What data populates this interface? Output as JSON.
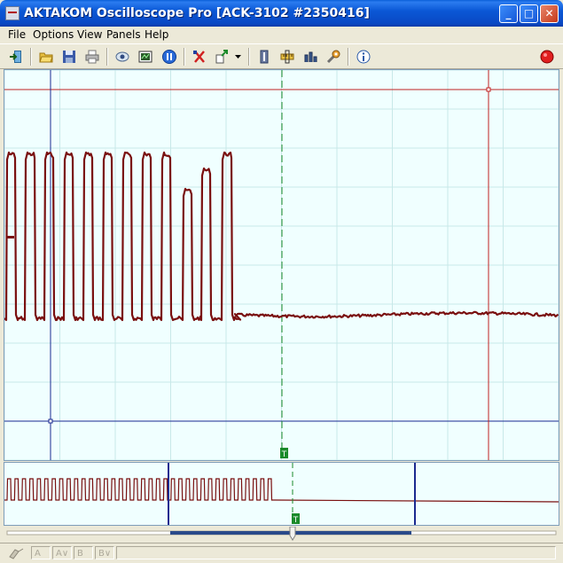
{
  "window": {
    "title": "AKTAKOM Oscilloscope Pro [ACK-3102 #2350416]",
    "minimize_glyph": "_",
    "maximize_glyph": "□",
    "close_glyph": "✕"
  },
  "menu": {
    "file": "File",
    "options": "Options",
    "view": "View",
    "panels": "Panels",
    "help": "Help"
  },
  "toolbar": {
    "icons": [
      "exit-icon",
      "open-folder-icon",
      "save-icon",
      "print-icon",
      "eye-icon",
      "snapshot-icon",
      "pause-icon",
      "cursor-cross-icon",
      "export-icon",
      "dropdown-arrow-icon",
      "channel-info-icon",
      "ruler-icon",
      "measure-icon",
      "wrench-icon",
      "info-icon",
      "record-icon"
    ]
  },
  "scope": {
    "trigger_marker": "T",
    "trace_color": "#7a1010",
    "grid_color": "#c8e8e8",
    "cursor_h_color": "#c02020",
    "cursor_v_color": "#1a2a90",
    "trigger_color": "#1a8a2a"
  },
  "overview": {
    "trigger_marker": "T"
  },
  "statusbar": {
    "cells": [
      "A",
      "A∨",
      "B",
      "B∨"
    ]
  }
}
